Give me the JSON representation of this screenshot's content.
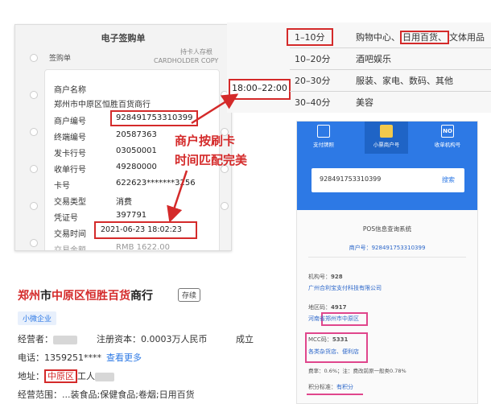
{
  "receipt": {
    "title": "电子签购单",
    "copy_cn": "持卡人存根",
    "copy_en": "CARDHOLDER COPY",
    "slip_label": "签购单",
    "fields": [
      {
        "label": "商户名称",
        "value": ""
      },
      {
        "label": "郑州市中原区恒胜百货商行",
        "value": ""
      },
      {
        "label": "商户编号",
        "value": "928491753310399"
      },
      {
        "label": "终端编号",
        "value": "20587363"
      },
      {
        "label": "发卡行号",
        "value": "03050001"
      },
      {
        "label": "收单行号",
        "value": "49280000"
      },
      {
        "label": "卡号",
        "value": "622623*******3256"
      },
      {
        "label": "交易类型",
        "value": "消费"
      },
      {
        "label": "凭证号",
        "value": "397791"
      },
      {
        "label": "交易时间",
        "value": "2021-06-23 18:02:23"
      },
      {
        "label": "交易金额",
        "value": "RMB 1622.00"
      }
    ]
  },
  "category_table": {
    "time_label": "18:00–22:00",
    "rows": [
      {
        "range": "1–10分",
        "category_pre": "购物中心、",
        "category_hl": "日用百货、",
        "category_post": "文体用品"
      },
      {
        "range": "10–20分",
        "category_pre": "酒吧娱乐",
        "category_hl": "",
        "category_post": ""
      },
      {
        "range": "20–30分",
        "category_pre": "服装、家电、数码、其他",
        "category_hl": "",
        "category_post": ""
      },
      {
        "range": "30–40分",
        "category_pre": "美容",
        "category_hl": "",
        "category_post": ""
      }
    ]
  },
  "overlay": {
    "line1": "商户按刷卡",
    "line2": "时间匹配完美"
  },
  "pos_panel": {
    "tabs": [
      {
        "icon": "",
        "label": "支付牌照"
      },
      {
        "icon": "",
        "label": "小票商户号"
      },
      {
        "icon": "NO",
        "label": "收单机构号"
      }
    ],
    "search_value": "928491753310399",
    "search_button": "搜索",
    "system_title": "POS信息查询系统",
    "merchant_no_label": "商户号：",
    "merchant_no": "928491753310399",
    "org_no_label": "机构号：",
    "org_no": "928",
    "org_name": "广州合利宝支付科技有限公司",
    "area_code_label": "地区码：",
    "area_code": "4917",
    "area_name": "河南省郑州市中原区",
    "mcc_label": "MCC码：",
    "mcc_code": "5331",
    "mcc_name": "各类杂货店、便利店",
    "rate_text": "费率：0.6%；注：费改前原一般类0.78%",
    "points_label": "积分标准：",
    "points_value": "有积分"
  },
  "company": {
    "name_parts": [
      {
        "text": "郑州",
        "red": true
      },
      {
        "text": "市",
        "red": false
      },
      {
        "text": "中原区",
        "red": true
      },
      {
        "text": "恒胜百货",
        "red": true
      },
      {
        "text": "商行",
        "red": false
      }
    ],
    "status_badge": "存续",
    "tag": "小微企业",
    "legal_rep_label": "经营者：",
    "reg_capital": "注册资本：0.0003万人民币",
    "established_label": "成立",
    "phone_label": "电话：",
    "phone_value": "1359251****",
    "phone_link": "查看更多",
    "address_label": "地址：",
    "address_hl": "中原区",
    "address_tail": "工人",
    "scope_label": "经营范围：",
    "scope_value": "...装食品;保健食品;卷烟;日用百货"
  },
  "colors": {
    "accent_red": "#d42a2a",
    "highlight_pink": "#e0468c",
    "pos_blue": "#2d79e5",
    "link_blue": "#2b66c9"
  }
}
